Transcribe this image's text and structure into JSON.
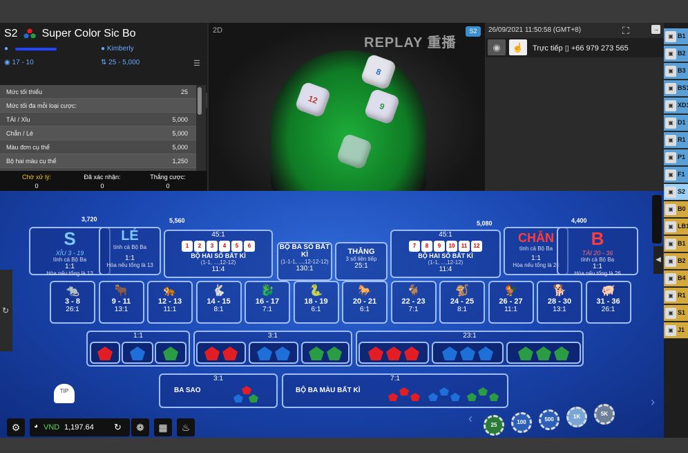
{
  "game": {
    "code": "S2",
    "name": "Super Color Sic Bo",
    "player": "Kimberly",
    "user_redacted": "",
    "hands": "17 - 10",
    "bet_range": "25 - 5,000"
  },
  "limits": {
    "header": "Mức tối thiểu",
    "header_val": "25",
    "rows": [
      {
        "label": "Mức tối đa mỗi loại cược:",
        "value": ""
      },
      {
        "label": "TÀI / Xỉu",
        "value": "5,000"
      },
      {
        "label": "Chẵn / Lẻ",
        "value": "5,000"
      },
      {
        "label": "Màu đơn cụ thể",
        "value": "5,000"
      },
      {
        "label": "Bộ hai màu cụ thể",
        "value": "1,250"
      }
    ]
  },
  "status": {
    "pending_label": "Chờ xử lý:",
    "pending": "0",
    "confirmed_label": "Đã xác nhận:",
    "confirmed": "0",
    "win_label": "Thắng cược:",
    "win": "0"
  },
  "video": {
    "mode": "2D",
    "replay": "REPLAY 重播",
    "badge": "S2"
  },
  "right": {
    "datetime": "26/09/2021 11:50:58 (GMT+8)",
    "live_label": "Trực tiếp",
    "phone": "+66 979 273 565"
  },
  "sidebar": [
    "B1",
    "B2",
    "B3",
    "BS1",
    "XD1",
    "D1",
    "R1",
    "P1",
    "F1",
    "S2",
    "B0",
    "LB1",
    "B1",
    "B2",
    "B4",
    "R1",
    "S1",
    "J1"
  ],
  "table": {
    "xiu": {
      "letter": "S",
      "title": "XỈU 3 - 19",
      "sub": "tính cả Bộ Ba",
      "odds": "1:1",
      "note": "Hòa nếu tổng là 13",
      "chips": "3,720"
    },
    "le": {
      "letter": "LẺ",
      "sub": "tính cả Bộ Ba",
      "odds": "1:1",
      "note": "Hòa nếu tổng là 13",
      "chips": "5,560"
    },
    "pairs_left": {
      "odds": "45:1",
      "title": "BỘ HAI SỐ BẤT KÌ",
      "range": "(1-1, ...,12-12)",
      "odds2": "11:4",
      "dice": [
        "1",
        "2",
        "3",
        "4",
        "5",
        "6"
      ]
    },
    "triple": {
      "title": "BỘ BA SỐ BẤT KÌ",
      "range": "(1-1-1, ...,12-12-12)",
      "odds": "130:1"
    },
    "straight": {
      "title": "THẲNG",
      "sub": "3 số liên tiếp",
      "odds": "25:1"
    },
    "pairs_right": {
      "odds": "45:1",
      "title": "BỘ HAI SỐ BẤT KÌ",
      "range": "(1-1, ...,12-12)",
      "odds2": "11:4",
      "dice": [
        "7",
        "8",
        "9",
        "10",
        "11",
        "12"
      ],
      "chips": "5,080"
    },
    "chan": {
      "letter": "CHẴN",
      "sub": "tính cả Bộ Ba",
      "odds": "1:1",
      "note": "Hòa nếu tổng là 26"
    },
    "tai": {
      "letter": "B",
      "title": "TÀI 20 - 36",
      "sub": "tính cả Bộ Ba",
      "odds": "1:1",
      "note": "Hòa nếu tổng là 26",
      "chips": "4,400"
    },
    "animals": [
      {
        "range": "3 - 8",
        "odds": "26:1"
      },
      {
        "range": "9 - 11",
        "odds": "13:1"
      },
      {
        "range": "12 - 13",
        "odds": "11:1"
      },
      {
        "range": "14 - 15",
        "odds": "8:1"
      },
      {
        "range": "16 - 17",
        "odds": "7:1"
      },
      {
        "range": "18 - 19",
        "odds": "6:1"
      },
      {
        "range": "20 - 21",
        "odds": "6:1"
      },
      {
        "range": "22 - 23",
        "odds": "7:1"
      },
      {
        "range": "24 - 25",
        "odds": "8:1"
      },
      {
        "range": "26 - 27",
        "odds": "11:1"
      },
      {
        "range": "28 - 30",
        "odds": "13:1"
      },
      {
        "range": "31 - 36",
        "odds": "26:1"
      }
    ],
    "colors": {
      "single": "1:1",
      "double": "3:1",
      "triple": "23:1"
    },
    "three_stars": {
      "title": "BA SAO",
      "odds": "3:1"
    },
    "any_color_triple": {
      "title": "BỘ BA MÀU BẤT KÌ",
      "odds": "7:1"
    }
  },
  "bottom": {
    "currency": "VND",
    "balance": "1,197.64",
    "tip": "TIP",
    "chips": [
      "25",
      "100",
      "500",
      "1K",
      "5K"
    ]
  }
}
